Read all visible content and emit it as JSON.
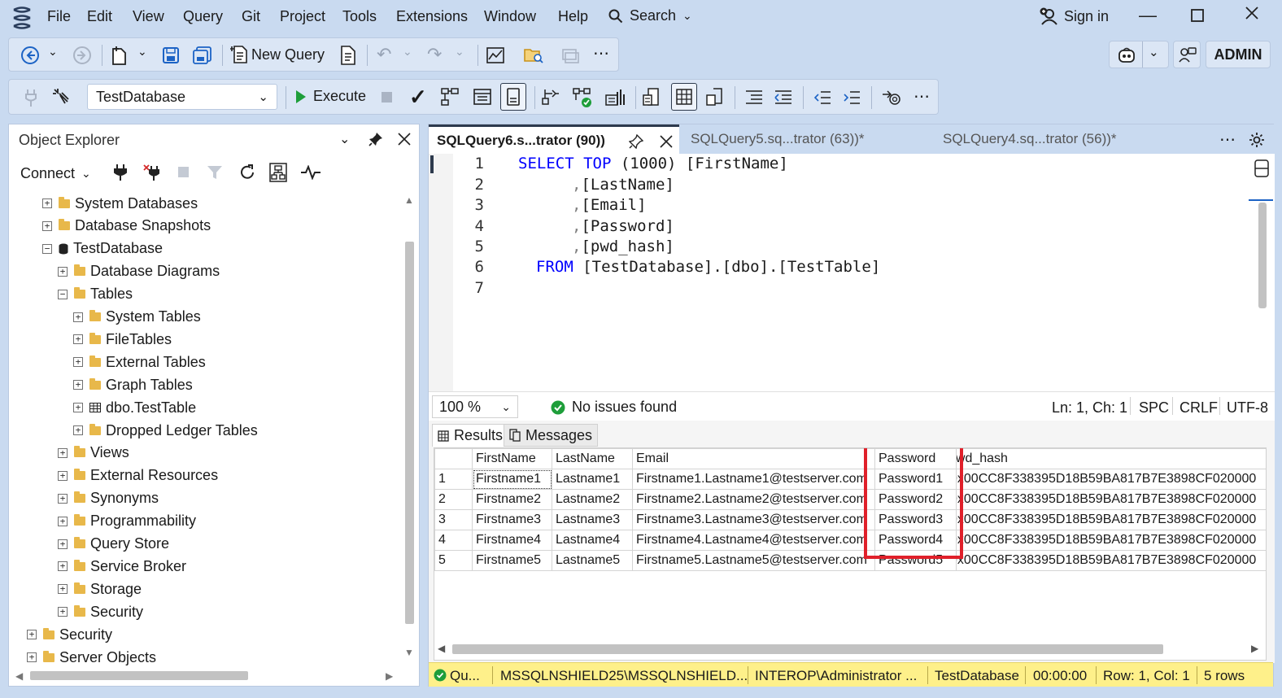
{
  "menu": {
    "items": [
      "File",
      "Edit",
      "View",
      "Query",
      "Git",
      "Project",
      "Tools",
      "Extensions",
      "Window",
      "Help"
    ],
    "search_label": "Search",
    "sign_in": "Sign in",
    "admin": "ADMIN"
  },
  "toolbar1": {
    "new_query": "New Query"
  },
  "toolbar2": {
    "database": "TestDatabase",
    "execute": "Execute"
  },
  "object_explorer": {
    "title": "Object Explorer",
    "connect": "Connect",
    "tree": [
      {
        "label": "System Databases",
        "icon": "folder",
        "expanded": false
      },
      {
        "label": "Database Snapshots",
        "icon": "folder",
        "expanded": false
      },
      {
        "label": "TestDatabase",
        "icon": "database",
        "expanded": true
      },
      {
        "label": "Database Diagrams",
        "icon": "folder",
        "expanded": false
      },
      {
        "label": "Tables",
        "icon": "folder",
        "expanded": true
      },
      {
        "label": "System Tables",
        "icon": "folder",
        "expanded": false
      },
      {
        "label": "FileTables",
        "icon": "folder",
        "expanded": false
      },
      {
        "label": "External Tables",
        "icon": "folder",
        "expanded": false
      },
      {
        "label": "Graph Tables",
        "icon": "folder",
        "expanded": false
      },
      {
        "label": "dbo.TestTable",
        "icon": "table",
        "expanded": false
      },
      {
        "label": "Dropped Ledger Tables",
        "icon": "folder",
        "expanded": false
      },
      {
        "label": "Views",
        "icon": "folder",
        "expanded": false
      },
      {
        "label": "External Resources",
        "icon": "folder",
        "expanded": false
      },
      {
        "label": "Synonyms",
        "icon": "folder",
        "expanded": false
      },
      {
        "label": "Programmability",
        "icon": "folder",
        "expanded": false
      },
      {
        "label": "Query Store",
        "icon": "folder",
        "expanded": false
      },
      {
        "label": "Service Broker",
        "icon": "folder",
        "expanded": false
      },
      {
        "label": "Storage",
        "icon": "folder",
        "expanded": false
      },
      {
        "label": "Security",
        "icon": "folder",
        "expanded": false
      },
      {
        "label": "Security",
        "icon": "folder",
        "expanded": false
      },
      {
        "label": "Server Objects",
        "icon": "folder",
        "expanded": false
      }
    ]
  },
  "tabs": [
    {
      "label": "SQLQuery6.s...trator (90))",
      "active": true
    },
    {
      "label": "SQLQuery5.sq...trator (63))*",
      "active": false
    },
    {
      "label": "SQLQuery4.sq...trator (56))*",
      "active": false
    }
  ],
  "code": {
    "line_numbers": [
      "1",
      "2",
      "3",
      "4",
      "5",
      "6",
      "7"
    ],
    "line1": {
      "kw1": "SELECT",
      "kw2": "TOP",
      "rest": " (1000) [FirstName]"
    },
    "line2": {
      "comma": ",",
      "col": "[LastName]"
    },
    "line3": {
      "comma": ",",
      "col": "[Email]"
    },
    "line4": {
      "comma": ",",
      "col": "[Password]"
    },
    "line5": {
      "comma": ",",
      "col": "[pwd_hash]"
    },
    "line6": {
      "kw": "FROM",
      "rest": " [TestDatabase].[dbo].[TestTable]"
    }
  },
  "editor_status": {
    "zoom": "100 %",
    "issues": "No issues found",
    "position": "Ln: 1, Ch: 1",
    "spc": "SPC",
    "crlf": "CRLF",
    "encoding": "UTF-8"
  },
  "results": {
    "tab_results": "Results",
    "tab_messages": "Messages",
    "columns": [
      "FirstName",
      "LastName",
      "Email",
      "Password",
      "pwd_hash"
    ],
    "rows": [
      [
        "1",
        "Firstname1",
        "Lastname1",
        "Firstname1.Lastname1@testserver.com",
        "Password1",
        "0x00CC8F338395D18B59BA817B7E3898CF020000"
      ],
      [
        "2",
        "Firstname2",
        "Lastname2",
        "Firstname2.Lastname2@testserver.com",
        "Password2",
        "0x00CC8F338395D18B59BA817B7E3898CF020000"
      ],
      [
        "3",
        "Firstname3",
        "Lastname3",
        "Firstname3.Lastname3@testserver.com",
        "Password3",
        "0x00CC8F338395D18B59BA817B7E3898CF020000"
      ],
      [
        "4",
        "Firstname4",
        "Lastname4",
        "Firstname4.Lastname4@testserver.com",
        "Password4",
        "0x00CC8F338395D18B59BA817B7E3898CF020000"
      ],
      [
        "5",
        "Firstname5",
        "Lastname5",
        "Firstname5.Lastname5@testserver.com",
        "Password5",
        "0x00CC8F338395D18B59BA817B7E3898CF020000"
      ]
    ],
    "highlight_color": "#e0202a"
  },
  "status_bar": {
    "state": "Qu...",
    "server": "MSSQLNSHIELD25\\MSSQLNSHIELD...",
    "user": "INTEROP\\Administrator ...",
    "database": "TestDatabase",
    "time": "00:00:00",
    "rowcol": "Row: 1, Col: 1",
    "rows": "5 rows"
  }
}
